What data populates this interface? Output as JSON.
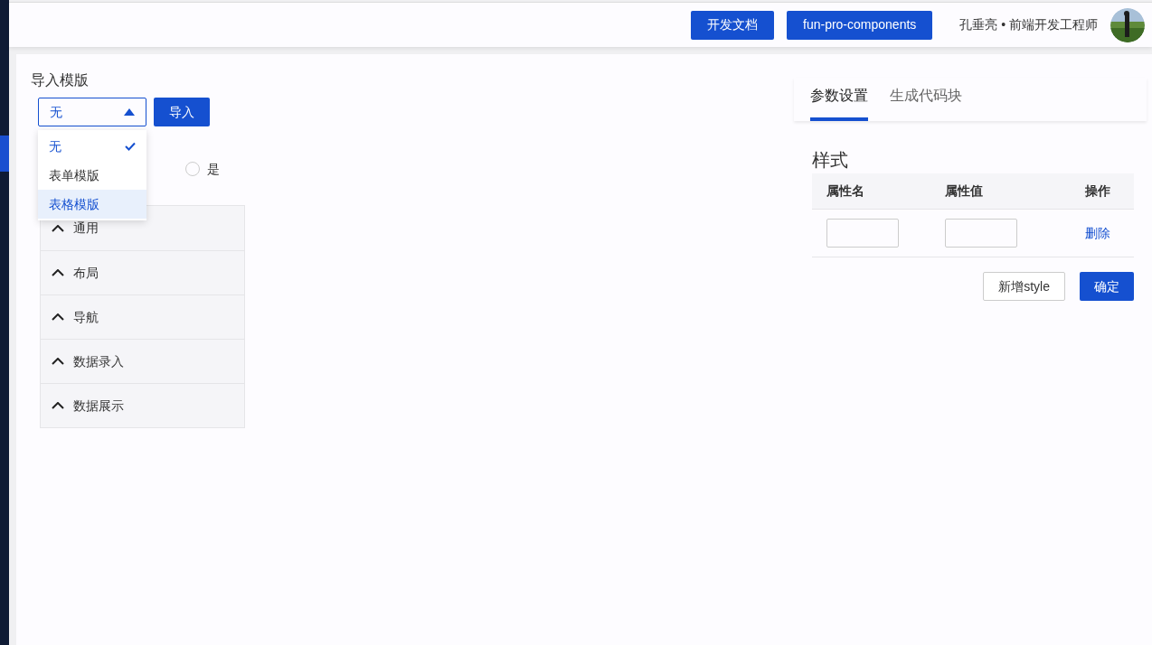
{
  "header": {
    "buttons": [
      "开发文档",
      "fun-pro-components"
    ],
    "user": "孔垂亮 • 前端开发工程师"
  },
  "import": {
    "title": "导入模版",
    "select": {
      "value": "无",
      "expanded": true
    },
    "button": "导入",
    "options": [
      {
        "label": "无",
        "selected": true,
        "hovered": false
      },
      {
        "label": "表单模版",
        "selected": false,
        "hovered": false
      },
      {
        "label": "表格模版",
        "selected": false,
        "hovered": true
      }
    ]
  },
  "radio": {
    "label": "是",
    "selected": false
  },
  "categories": [
    {
      "label": "通用",
      "expanded": true
    },
    {
      "label": "布局",
      "expanded": true
    },
    {
      "label": "导航",
      "expanded": true
    },
    {
      "label": "数据录入",
      "expanded": true
    },
    {
      "label": "数据展示",
      "expanded": true
    }
  ],
  "tabs": [
    {
      "label": "参数设置",
      "selected": true
    },
    {
      "label": "生成代码块",
      "selected": false
    }
  ],
  "style": {
    "title": "样式",
    "columns": [
      "属性名",
      "属性值",
      "操作"
    ],
    "rows": [
      {
        "name": "",
        "value": "",
        "action": "删除"
      }
    ],
    "buttons": [
      "新增style",
      "确定"
    ]
  }
}
